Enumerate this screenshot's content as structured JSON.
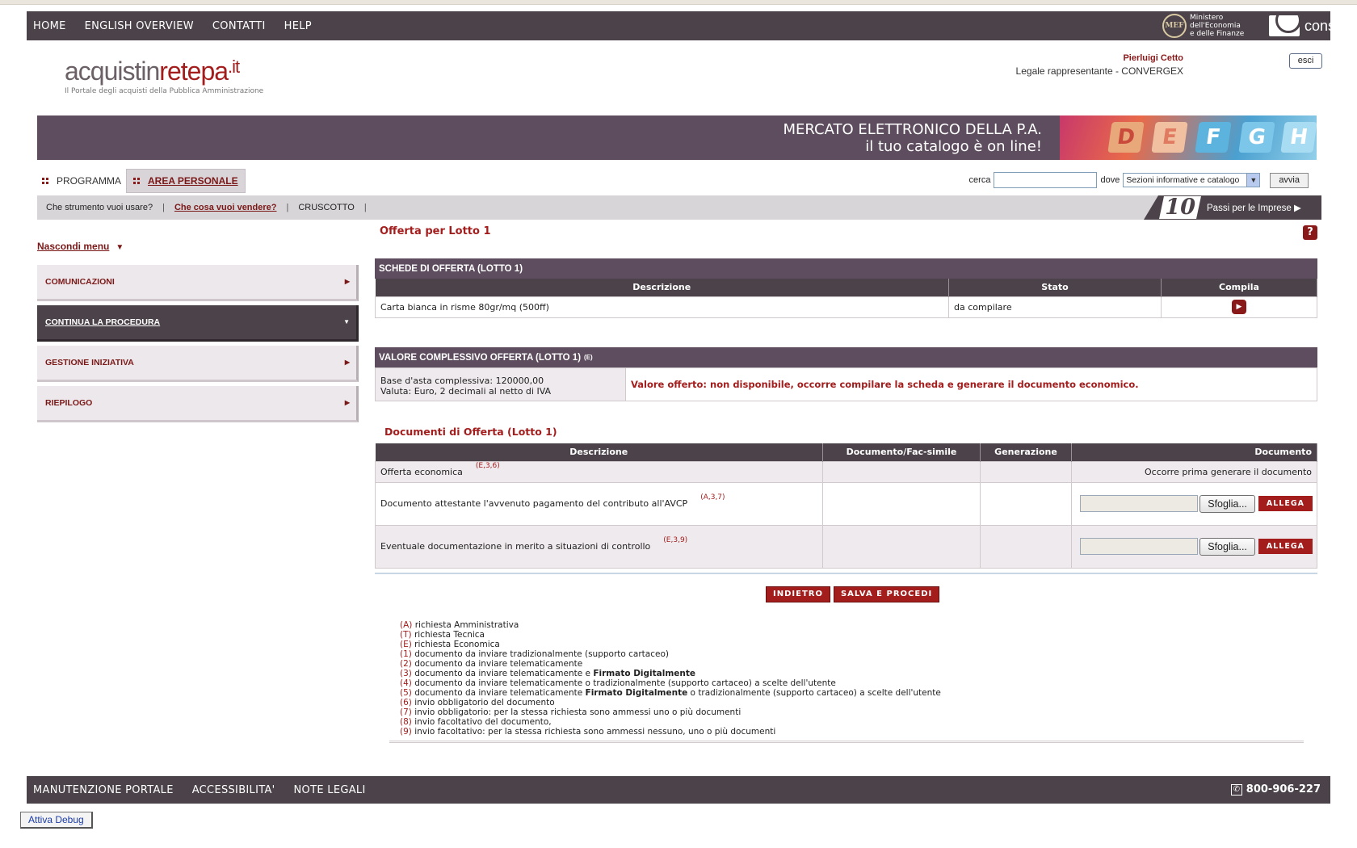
{
  "topnav": {
    "items": [
      "HOME",
      "ENGLISH OVERVIEW",
      "CONTATTI",
      "HELP"
    ]
  },
  "mef": {
    "abbr": "MEF",
    "line1": "Ministero",
    "line2": "dell'Economia",
    "line3": "e delle Finanze"
  },
  "consip": {
    "name": "consip"
  },
  "brand": {
    "part1": "acquistin",
    "part2": "retepa",
    "part3": ".it",
    "tagline": "Il Portale degli acquisti della Pubblica Amministrazione"
  },
  "user": {
    "name": "Pierluigi Cetto",
    "role": "Legale rappresentante - CONVERGEX",
    "logout": "esci"
  },
  "banner": {
    "line1": "MERCATO ELETTRONICO DELLA P.A.",
    "line2": "il tuo catalogo è on line!",
    "tiles": [
      "D",
      "E",
      "F",
      "G",
      "H"
    ]
  },
  "nav": {
    "programma": "PROGRAMMA",
    "area": "AREA PERSONALE",
    "search_label": "cerca",
    "where_label": "dove",
    "where_value": "Sezioni informative e catalogo",
    "go": "avvia"
  },
  "subnav": {
    "q1": "Che strumento vuoi usare?",
    "q2": "Che cosa vuoi vendere?",
    "q3": "CRUSCOTTO",
    "sep": "|"
  },
  "badge": {
    "num": "10",
    "label": "Passi per le Imprese"
  },
  "sidebar": {
    "toggle": "Nascondi menu",
    "items": [
      {
        "label": "COMUNICAZIONI"
      },
      {
        "label": "CONTINUA LA PROCEDURA"
      },
      {
        "label": "GESTIONE INIZIATIVA"
      },
      {
        "label": "RIEPILOGO"
      }
    ]
  },
  "main": {
    "title": "Offerta per Lotto 1",
    "help": "?",
    "schede": {
      "heading": "SCHEDE DI OFFERTA (LOTTO 1)",
      "cols": [
        "Descrizione",
        "Stato",
        "Compila"
      ],
      "row": {
        "desc": "Carta bianca in risme 80gr/mq (500ff)",
        "stato": "da compilare"
      }
    },
    "valore": {
      "heading": "VALORE COMPLESSIVO OFFERTA (LOTTO 1)",
      "sup": "(E)",
      "base": "Base d'asta complessiva: 120000,00",
      "valuta": "Valuta: Euro, 2 decimali al netto di IVA",
      "msg": "Valore offerto: non disponibile, occorre compilare la scheda e generare il documento economico."
    },
    "docs": {
      "heading": "Documenti di Offerta (Lotto 1)",
      "cols": [
        "Descrizione",
        "Documento/Fac-simile",
        "Generazione",
        "Documento"
      ],
      "rows": [
        {
          "desc": "Offerta economica",
          "ref": "(E,3,6)",
          "doc": "Occorre prima generare il documento"
        },
        {
          "desc": "Documento attestante l'avvenuto pagamento del contributo all'AVCP",
          "ref": "(A,3,7)",
          "browse": "Sfoglia...",
          "attach": "ALLEGA"
        },
        {
          "desc": "Eventuale documentazione in merito a situazioni di controllo",
          "ref": "(E,3,9)",
          "browse": "Sfoglia...",
          "attach": "ALLEGA"
        }
      ]
    },
    "buttons": {
      "back": "INDIETRO",
      "save": "SALVA E PROCEDI"
    }
  },
  "legend": [
    {
      "k": "(A)",
      "pre": "richiesta Amministrativa",
      "bold": "",
      "post": ""
    },
    {
      "k": "(T)",
      "pre": "richiesta Tecnica",
      "bold": "",
      "post": ""
    },
    {
      "k": "(E)",
      "pre": "richiesta Economica",
      "bold": "",
      "post": ""
    },
    {
      "k": "(1)",
      "pre": "documento da inviare tradizionalmente (supporto cartaceo)",
      "bold": "",
      "post": ""
    },
    {
      "k": "(2)",
      "pre": "documento da inviare telematicamente",
      "bold": "",
      "post": ""
    },
    {
      "k": "(3)",
      "pre": "documento da inviare telematicamente e ",
      "bold": "Firmato Digitalmente",
      "post": ""
    },
    {
      "k": "(4)",
      "pre": "documento da inviare telematicamente o tradizionalmente (supporto cartaceo) a scelte dell'utente",
      "bold": "",
      "post": ""
    },
    {
      "k": "(5)",
      "pre": "documento da inviare telematicamente ",
      "bold": "Firmato Digitalmente",
      "post": " o tradizionalmente (supporto cartaceo) a scelte dell'utente"
    },
    {
      "k": "(6)",
      "pre": "invio obbligatorio del documento",
      "bold": "",
      "post": ""
    },
    {
      "k": "(7)",
      "pre": "invio obbligatorio: per la stessa richiesta sono ammessi uno o più documenti",
      "bold": "",
      "post": ""
    },
    {
      "k": "(8)",
      "pre": "invio facoltativo del documento,",
      "bold": "",
      "post": ""
    },
    {
      "k": "(9)",
      "pre": "invio facoltativo: per la stessa richiesta sono ammessi nessuno, uno o più documenti",
      "bold": "",
      "post": ""
    }
  ],
  "footer": {
    "items": [
      "MANUTENZIONE PORTALE",
      "ACCESSIBILITA'",
      "NOTE LEGALI"
    ],
    "phone": "800-906-227",
    "phone_icon": "✆"
  },
  "debug": "Attiva Debug"
}
